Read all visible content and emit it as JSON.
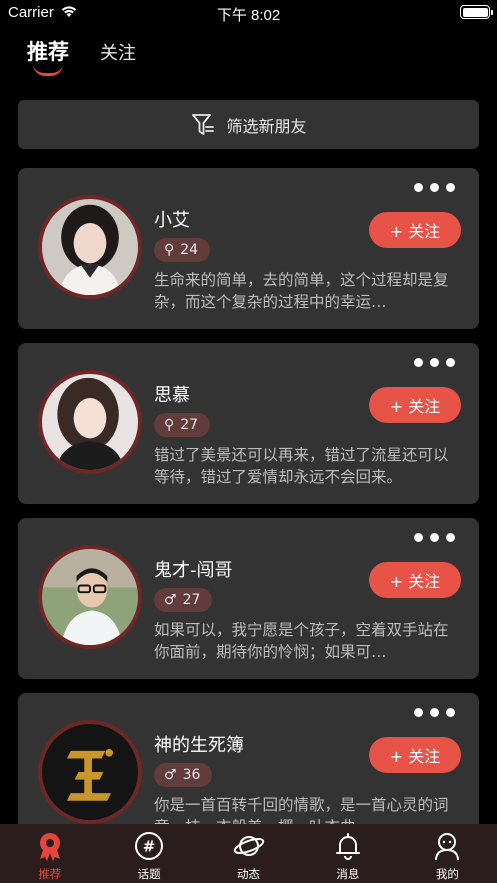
{
  "status_bar": {
    "carrier": "Carrier",
    "time": "下午 8:02"
  },
  "top_tabs": {
    "recommend": "推荐",
    "follow": "关注"
  },
  "filter": {
    "label": "筛选新朋友"
  },
  "cards": [
    {
      "name": "小艾",
      "gender_symbol": "⚲",
      "age": "24",
      "bio": "生命来的简单，去的简单，这个过程却是复杂，而这个复杂的过程中的幸运…",
      "follow_label": "+ 关注"
    },
    {
      "name": "思慕",
      "gender_symbol": "⚲",
      "age": "27",
      "bio": "错过了美景还可以再来，错过了流星还可以等待，错过了爱情却永远不会回来。",
      "follow_label": "+ 关注"
    },
    {
      "name": "鬼才-闯哥",
      "gender_symbol": "♂",
      "age": "27",
      "bio": "如果可以，我宁愿是个孩子，空着双手站在你面前，期待你的怜悯；如果可…",
      "follow_label": "+ 关注"
    },
    {
      "name": "神的生死簿",
      "gender_symbol": "♂",
      "age": "36",
      "bio": "你是一首百转千回的情歌，是一首心灵的词章，枝、衣般美、樱、叶衣曲",
      "follow_label": "+ 关注"
    }
  ],
  "tab_bar": [
    {
      "label": "推荐",
      "icon": "recommend-icon",
      "active": true
    },
    {
      "label": "话题",
      "icon": "hashtag-icon",
      "active": false
    },
    {
      "label": "动态",
      "icon": "planet-icon",
      "active": false
    },
    {
      "label": "消息",
      "icon": "bell-icon",
      "active": false
    },
    {
      "label": "我的",
      "icon": "user-icon",
      "active": false
    }
  ],
  "colors": {
    "accent": "#e85347",
    "card_bg": "#333334",
    "badge_bg": "#613c3b",
    "tabbar_bg": "#2b1d1c"
  }
}
